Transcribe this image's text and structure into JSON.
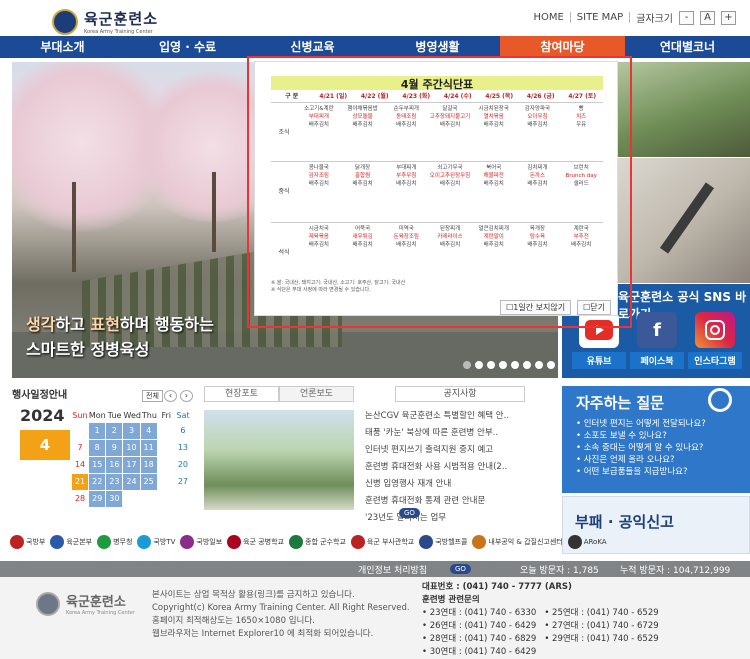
{
  "header": {
    "logo_title": "육군훈련소",
    "logo_sub": "Korea Army Training Center",
    "links": [
      "HOME",
      "SITE MAP",
      "글자크기"
    ],
    "font_minus": "-",
    "font_a": "A",
    "font_plus": "+"
  },
  "nav": [
    "부대소개",
    "입영 · 수료",
    "신병교육",
    "병영생활",
    "참여마당",
    "연대별코너"
  ],
  "banner": {
    "slogan_line1_a": "생각",
    "slogan_line1_b": "하고 ",
    "slogan_line1_c": "표현",
    "slogan_line1_d": "하며 행동하는",
    "slogan_line2": "스마트한 정병육성"
  },
  "popup": {
    "title": "4월  주간식단표",
    "head": [
      "구 분",
      "4/21 (일)",
      "4/22 (월)",
      "4/23 (화)",
      "4/24 (수)",
      "4/25 (목)",
      "4/26 (금)",
      "4/27 (토)"
    ],
    "rows": [
      {
        "label": "조식",
        "cols": [
          [
            "소고기&계란",
            "부대찌개",
            "배추김치"
          ],
          [
            "햄야채볶음밥",
            "상모돌물",
            "배추김치"
          ],
          [
            "순두부찌개",
            "동태조림",
            "배추김치"
          ],
          [
            "달걀국",
            "고추장돼지불고기",
            "배추김치"
          ],
          [
            "시금치된장국",
            "열치볶음",
            "배추김치"
          ],
          [
            "감자양파국",
            "오이무침",
            "배추김치"
          ],
          [
            "빵",
            "치즈",
            "우유"
          ]
        ]
      },
      {
        "label": "중식",
        "cols": [
          [
            "콩나물국",
            "감자조림",
            "배추김치"
          ],
          [
            "닭개장",
            "홍합찜",
            "배추김치"
          ],
          [
            "부대찌개",
            "부추무침",
            "배추김치"
          ],
          [
            "쇠고기무국",
            "오이고추된장무침",
            "배추김치"
          ],
          [
            "북어국",
            "해물파전",
            "배추김치"
          ],
          [
            "김치찌개",
            "돈까스",
            "배추김치"
          ],
          [
            "브런치",
            "Brunch day",
            "샐러드"
          ]
        ]
      },
      {
        "label": "석식",
        "cols": [
          [
            "시금치국",
            "제육볶음",
            "배추김치"
          ],
          [
            "어묵국",
            "새우튀김",
            "배추김치"
          ],
          [
            "미역국",
            "돈육장조림",
            "배추김치"
          ],
          [
            "된장찌개",
            "카레라이스",
            "배추김치"
          ],
          [
            "얼큰김치찌개",
            "계란말이",
            "배추김치"
          ],
          [
            "육개장",
            "탕수육",
            "배추김치"
          ],
          [
            "계란국",
            "부추전",
            "배추김치"
          ]
        ]
      }
    ],
    "footnote1": "※ 쌀: 국내산, 돼지고기: 국내산, 소고기: 호주산, 닭고기: 국내산",
    "footnote2": "※ 식단은 부대 사정에 따라 변경될 수 있습니다.",
    "btn_hide": "1일간 보지않기",
    "btn_close": "닫기"
  },
  "sns": {
    "title": "육군훈련소 공식 SNS 바로가기",
    "items": [
      {
        "label": "유튜브",
        "color": "#e52d27",
        "icon": "youtube-icon"
      },
      {
        "label": "페이스북",
        "color": "#3b5998",
        "icon": "facebook-icon"
      },
      {
        "label": "인스타그램",
        "color": "#c13584",
        "icon": "instagram-icon"
      }
    ]
  },
  "schedule": {
    "title": "행사일정안내",
    "btn_all": "전체",
    "year": "2024",
    "month": "4",
    "days": [
      "Sun",
      "Mon",
      "Tue",
      "Wed",
      "Thu",
      "Fri",
      "Sat"
    ],
    "weeks": [
      [
        "",
        "1",
        "2",
        "3",
        "4",
        "5",
        "6"
      ],
      [
        "7",
        "8",
        "9",
        "10",
        "11",
        "12",
        "13"
      ],
      [
        "14",
        "15",
        "16",
        "17",
        "18",
        "19",
        "20"
      ],
      [
        "21",
        "22",
        "23",
        "24",
        "25",
        "26",
        "27"
      ],
      [
        "28",
        "29",
        "30",
        "",
        "",
        "",
        ""
      ]
    ]
  },
  "tabs": [
    "현장포토",
    "언론보도"
  ],
  "notice": {
    "tab": "공지사항",
    "items": [
      "논산CGV 육군훈련소 특별할인 혜택 안..",
      "태풍 '카눈' 북상에 따른 훈련병 안부..",
      "인터넷 편지쓰기 출력지원 중지 예고",
      "훈련병 휴대전화 사용 시범적용 안내(2..",
      "신병 입영행사 재개 안내",
      "훈련병 휴대전화 통제 관련 안내문",
      "'23년도 달라지는 업무"
    ],
    "go": "GO"
  },
  "faq": {
    "title": "자주하는 질문",
    "items": [
      "인터넷 편지는 어떻게 전달되나요?",
      "소포도 보낼 수 있나요?",
      "소속 중대는 어떻게 알 수 있나요?",
      "사진은 언제 올라 오나요?",
      "어떤 보급품들을 지급받나요?"
    ]
  },
  "ad": {
    "text": "부패 · 공익신고"
  },
  "partners": [
    "국방부",
    "육군본부",
    "병무청",
    "국방TV",
    "국방일보",
    "육군 공병학교",
    "종합 군수학교",
    "육군 부사관학교",
    "국방헬프콜",
    "내부공익 & 갑질신고센터",
    "ARoKA"
  ],
  "footerbar": {
    "privacy": "개인정보 처리방침",
    "go": "GO",
    "today": "오늘 방문자 : 1,785",
    "total": "누적 방문자 : 104,712,999"
  },
  "footer": {
    "logo_title": "육군훈련소",
    "logo_sub": "Korea Army Training Center",
    "text": [
      "본사이트는 상업 목적상 활용(링크)를 금지하고 있습니다.",
      "Copyright(c) Korea Army Training Center. All Right Reserved.",
      "홈페이지 최적해상도는 1650×1080 입니다.",
      "웹브라우저는 Internet Explorer10 에 최적화 되어있습니다."
    ],
    "main_tel": "대표번호 : (041) 740 - 7777 (ARS)",
    "contact_title": "훈련병 관련문의",
    "contacts": [
      "• 23연대 : (041) 740 - 6330",
      "• 25연대 : (041) 740 - 6529",
      "• 26연대 : (041) 740 - 6429",
      "• 27연대 : (041) 740 - 6729",
      "• 28연대 : (041) 740 - 6829",
      "• 29연대 : (041) 740 - 6529",
      "• 30연대 : (041) 740 - 6429"
    ]
  }
}
